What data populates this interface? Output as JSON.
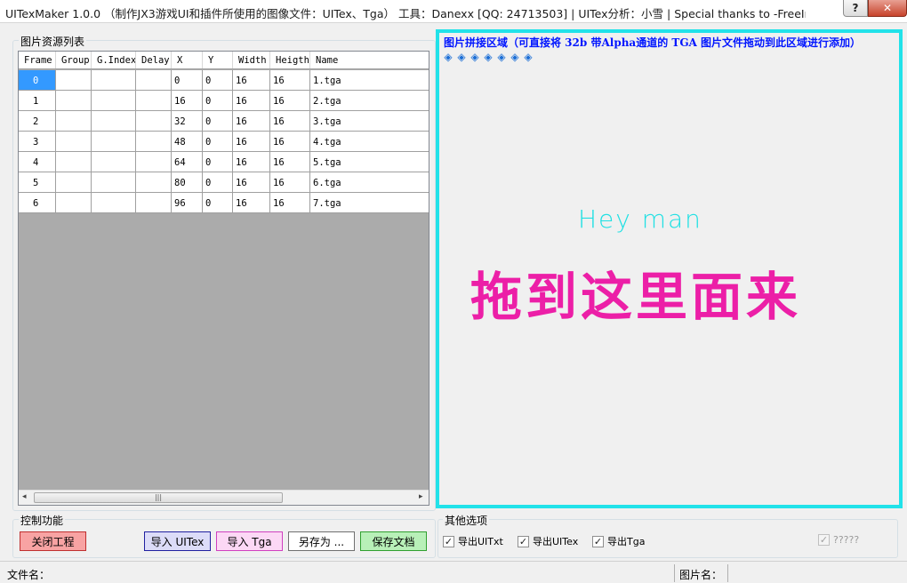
{
  "window": {
    "title": "UITexMaker  1.0.0 （制作JX3游戏UI和插件所使用的图像文件：UITex、Tga）  工具：Danexx [QQ: 24713503] | UITex分析：小雪 | Special thanks to -FreeImage-",
    "help_label": "?",
    "close_label": "✕"
  },
  "resource_list": {
    "label": "图片资源列表",
    "columns": [
      "Frame",
      "Group",
      "G.Index",
      "Delay",
      "X",
      "Y",
      "Width",
      "Heigth",
      "Name"
    ],
    "rows": [
      [
        "0",
        "",
        "",
        "",
        "0",
        "0",
        "16",
        "16",
        "1.tga"
      ],
      [
        "1",
        "",
        "",
        "",
        "16",
        "0",
        "16",
        "16",
        "2.tga"
      ],
      [
        "2",
        "",
        "",
        "",
        "32",
        "0",
        "16",
        "16",
        "3.tga"
      ],
      [
        "3",
        "",
        "",
        "",
        "48",
        "0",
        "16",
        "16",
        "4.tga"
      ],
      [
        "4",
        "",
        "",
        "",
        "64",
        "0",
        "16",
        "16",
        "5.tga"
      ],
      [
        "5",
        "",
        "",
        "",
        "80",
        "0",
        "16",
        "16",
        "6.tga"
      ],
      [
        "6",
        "",
        "",
        "",
        "96",
        "0",
        "16",
        "16",
        "7.tga"
      ]
    ],
    "scroll_left": "◂",
    "scroll_right": "▸",
    "scroll_grip": "|||"
  },
  "canvas": {
    "title": "图片拼接区域（可直接将 32b 带Alpha通道的 TGA 图片文件拖动到此区域进行添加）",
    "gem_icon": "gem-icon",
    "gem_glyph": "◈",
    "gem_count": 7,
    "hey_text": "Hey man",
    "drag_text": "拖到这里面来"
  },
  "controls": {
    "label": "控制功能",
    "close_project": "关闭工程",
    "import_uitex": "导入 UITex",
    "import_tga": "导入 Tga",
    "save_as": "另存为 ...",
    "save_doc": "保存文档"
  },
  "options": {
    "label": "其他选项",
    "export_uitxt": "导出UITxt",
    "export_uitex": "导出UITex",
    "export_tga": "导出Tga",
    "unknown": "?????",
    "check_glyph": "✓"
  },
  "status": {
    "file_name_label": "文件名：",
    "image_name_label": "图片名："
  },
  "colors": {
    "canvas_border": "#21e2e9",
    "canvas_title": "#0015ff",
    "hey_text": "#1fe0e3",
    "drag_text": "#ec1fa7",
    "selected_cell": "#3399ff"
  }
}
